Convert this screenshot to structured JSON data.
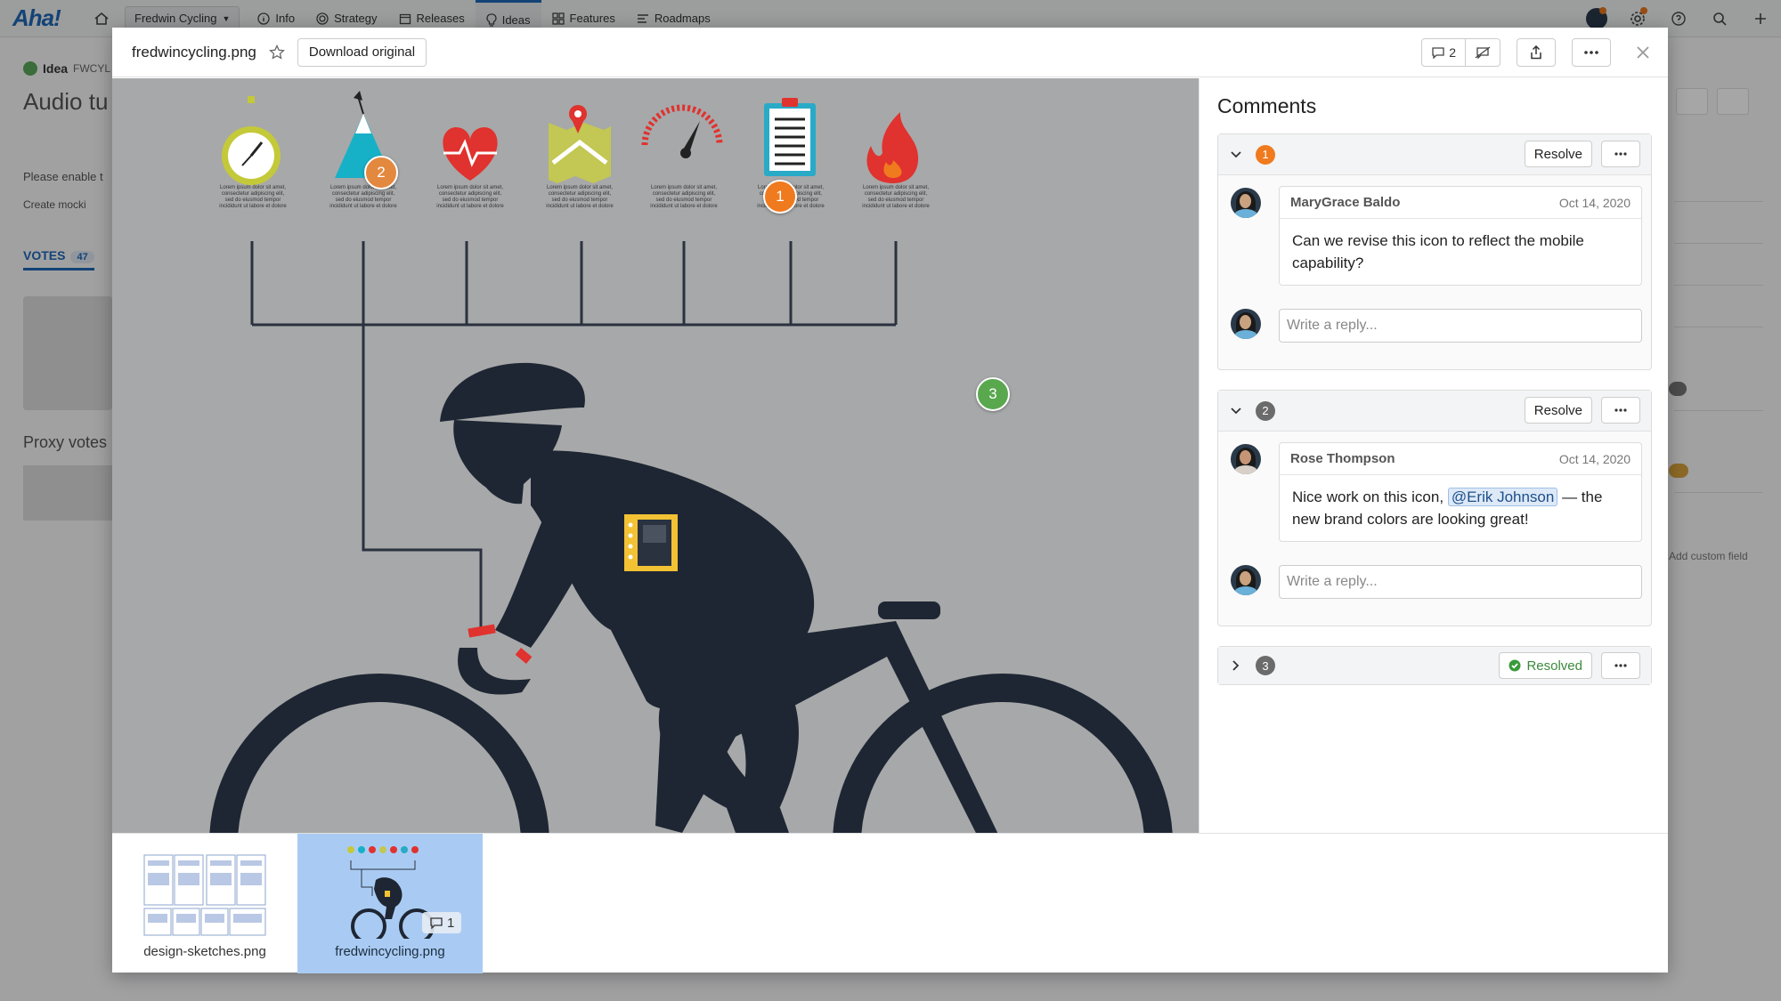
{
  "nav": {
    "logo": "Aha!",
    "workspace": "Fredwin Cycling",
    "items": [
      {
        "label": "Info",
        "icon": "info-icon"
      },
      {
        "label": "Strategy",
        "icon": "target-icon"
      },
      {
        "label": "Releases",
        "icon": "calendar-icon"
      },
      {
        "label": "Ideas",
        "icon": "lightbulb-icon",
        "active": true
      },
      {
        "label": "Features",
        "icon": "grid-icon"
      },
      {
        "label": "Roadmaps",
        "icon": "roadmap-icon"
      }
    ]
  },
  "background": {
    "idea_label": "Idea",
    "idea_ref": "FWCYL",
    "title": "Audio tu",
    "please_enable": "Please enable t",
    "create_mock": "Create mocki",
    "votes_label": "VOTES",
    "votes_count": "47",
    "proxy_votes": "Proxy votes",
    "add_custom_field": "Add custom field"
  },
  "modal": {
    "filename": "fredwincycling.png",
    "download_label": "Download original",
    "comment_count": "2"
  },
  "image": {
    "pins": [
      {
        "label": "2",
        "color": "#e3883f"
      },
      {
        "label": "1",
        "color": "#f07a1e"
      },
      {
        "label": "3",
        "color": "#59a84e"
      }
    ],
    "lorem": [
      "Lorem ipsum dolor sit amet,",
      "consectetur adipiscing elit,",
      "sed do eiusmod tempor",
      "incididunt ut labore et dolore"
    ]
  },
  "comments": {
    "title": "Comments",
    "threads": [
      {
        "number": "1",
        "color": "#f07a1e",
        "action": "Resolve",
        "author": "MaryGrace Baldo",
        "date": "Oct 14, 2020",
        "text": "Can we revise this icon to reflect the mobile capability?",
        "reply_placeholder": "Write a reply..."
      },
      {
        "number": "2",
        "color": "#6b6b6b",
        "action": "Resolve",
        "author": "Rose Thompson",
        "date": "Oct 14, 2020",
        "text_before": "Nice work on this icon,",
        "mention": "@Erik Johnson",
        "text_after": "— the new brand colors are looking great!",
        "reply_placeholder": "Write a reply..."
      },
      {
        "number": "3",
        "color": "#6b6b6b",
        "action": "Resolved"
      }
    ]
  },
  "thumbnails": [
    {
      "caption": "design-sketches.png"
    },
    {
      "caption": "fredwincycling.png",
      "selected": true,
      "comment_badge": "1"
    }
  ]
}
